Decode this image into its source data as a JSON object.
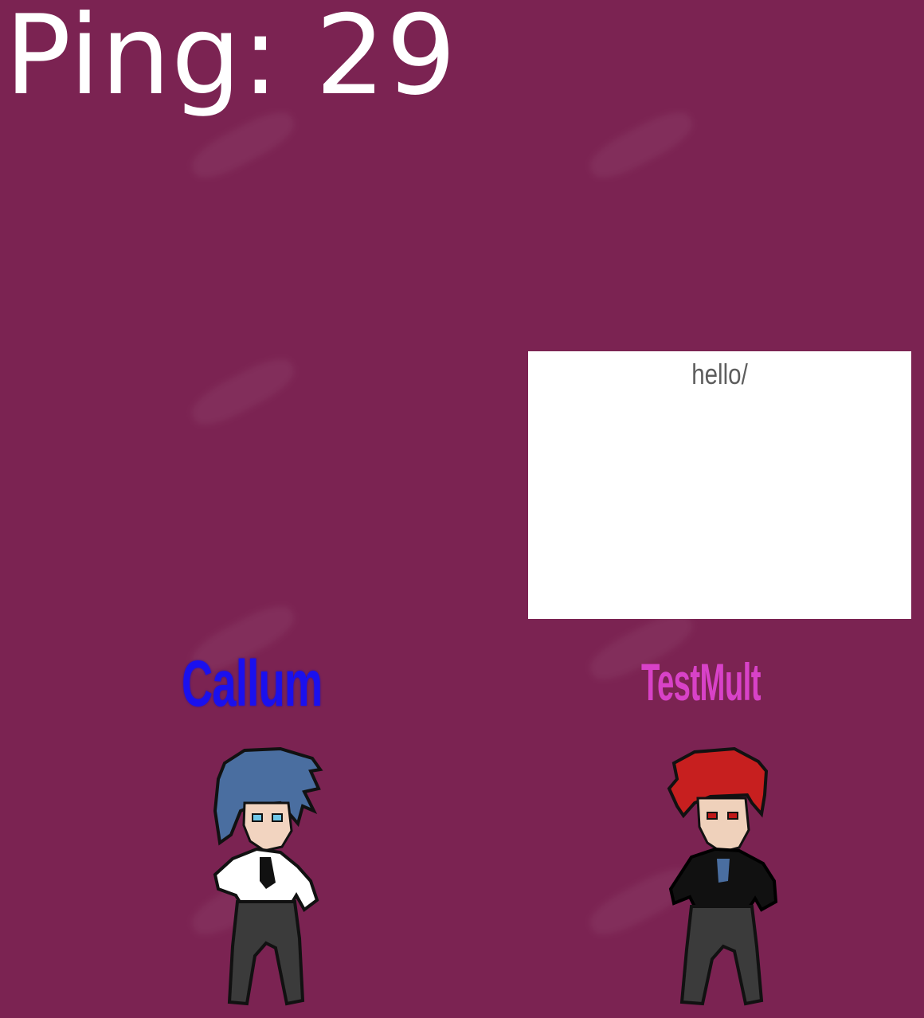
{
  "hud": {
    "ping_label": "Ping: 29"
  },
  "chat": {
    "message": "hello/"
  },
  "players": [
    {
      "name": "Callum",
      "name_color": "#1a10ee",
      "hair": "#4a6ea0",
      "shirt": "#ffffff"
    },
    {
      "name": "TestMult",
      "name_color": "#d842c8",
      "hair": "#c71f1f",
      "shirt": "#111111"
    }
  ],
  "colors": {
    "background": "#7b2352",
    "chat_background": "#ffffff",
    "chat_text": "#5d5d5d",
    "hud_text": "#ffffff"
  }
}
